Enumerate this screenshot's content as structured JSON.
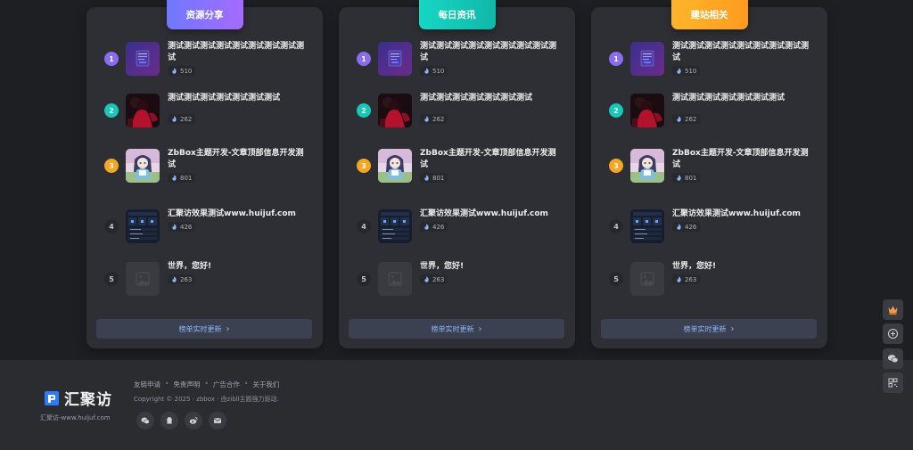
{
  "cards": [
    {
      "tab_label": "资源分享",
      "tab_color_start": "#6f78ff",
      "tab_color_end": "#a56bff",
      "more_label": "榜单实时更新"
    },
    {
      "tab_label": "每日资讯",
      "tab_color_start": "#17d6c4",
      "tab_color_end": "#10b8a9",
      "more_label": "榜单实时更新"
    },
    {
      "tab_label": "建站相关",
      "tab_color_start": "#ffb52a",
      "tab_color_end": "#ff9a1f",
      "more_label": "榜单实时更新"
    }
  ],
  "items": [
    {
      "rank": "1",
      "title": "测试测试测试测试测试测试测试测试测试",
      "views": "510",
      "thumb": "ui-screen",
      "rank_color": "#8a6cf0"
    },
    {
      "rank": "2",
      "title": "测试测试测试测试测试测试测试",
      "views": "262",
      "thumb": "red-figure",
      "rank_color": "#16c8b8"
    },
    {
      "rank": "3",
      "title": "ZbBox主题开发-文章顶部信息开发测试",
      "views": "801",
      "thumb": "anime-girl",
      "rank_color": "#f5a623"
    },
    {
      "rank": "4",
      "title": "汇聚访效果测试www.huijuf.com",
      "views": "426",
      "thumb": "dashboard",
      "rank_color": "#26272b"
    },
    {
      "rank": "5",
      "title": "世界，您好!",
      "views": "263",
      "thumb": "placeholder",
      "rank_color": "#26272b"
    }
  ],
  "footer": {
    "brand": "汇聚访",
    "site": "汇聚访-www.huijuf.com",
    "links": [
      "友链申请",
      "免责声明",
      "广告合作",
      "关于我们"
    ],
    "copyright": "Copyright © 2025 · zbbox · 由zibll主题强力驱动."
  },
  "icons": {
    "views": "flame-icon",
    "socials": [
      "wechat-icon",
      "qq-icon",
      "weibo-icon",
      "mail-icon"
    ],
    "side": [
      "crown-icon",
      "plus-circle-icon",
      "wechat-icon",
      "qrcode-icon"
    ]
  },
  "colors": {
    "accent_link": "#8fb6ff",
    "card_bg": "#2e2f34"
  }
}
